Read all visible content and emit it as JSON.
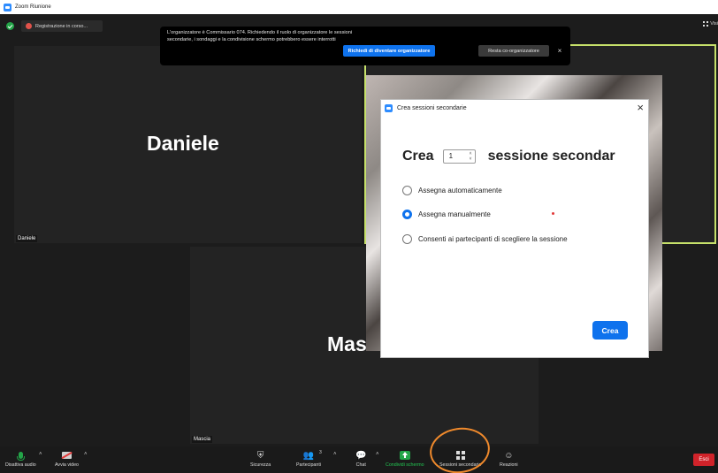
{
  "window": {
    "title": "Zoom Riunione"
  },
  "top": {
    "recording_label": "Registrazione in corso...",
    "view_label": "Visi"
  },
  "notice": {
    "message": "L'organizzatore è Commissario 074. Richiedendo il ruolo di organizzatore le sessioni secondarie, i sondaggi e la condivisione schermo potrebbero essere interrotti",
    "claim_button": "Richiedi di diventare organizzatore",
    "stay_button": "Resta co-organizzatore",
    "close": "×"
  },
  "tiles": {
    "daniele": {
      "big_name": "Daniele",
      "name_tag": "Daniele"
    },
    "mascia": {
      "big_name": "Mas",
      "name_tag": "Mascia"
    }
  },
  "dialog": {
    "title": "Crea sessioni secondarie",
    "close": "×",
    "create_word": "Crea",
    "count": "1",
    "sessions_word": "sessione secondar",
    "options": [
      {
        "label": "Assegna automaticamente",
        "checked": false
      },
      {
        "label": "Assegna manualmente",
        "checked": true
      },
      {
        "label": "Consenti ai partecipanti di scegliere la sessione",
        "checked": false
      }
    ],
    "create_button": "Crea"
  },
  "toolbar": {
    "mute": "Disattiva audio",
    "video": "Avvia video",
    "security": "Sicurezza",
    "participants": "Partecipanti",
    "participants_count": "3",
    "chat": "Chat",
    "share": "Condividi schermo",
    "sessions": "Sessioni secondarie",
    "reactions": "Reazioni",
    "exit": "Esci"
  },
  "colors": {
    "accent": "#0e72ed",
    "active_speaker_border": "#c6e06a",
    "exit": "#d1232a",
    "annotation": "#f08a2c"
  }
}
